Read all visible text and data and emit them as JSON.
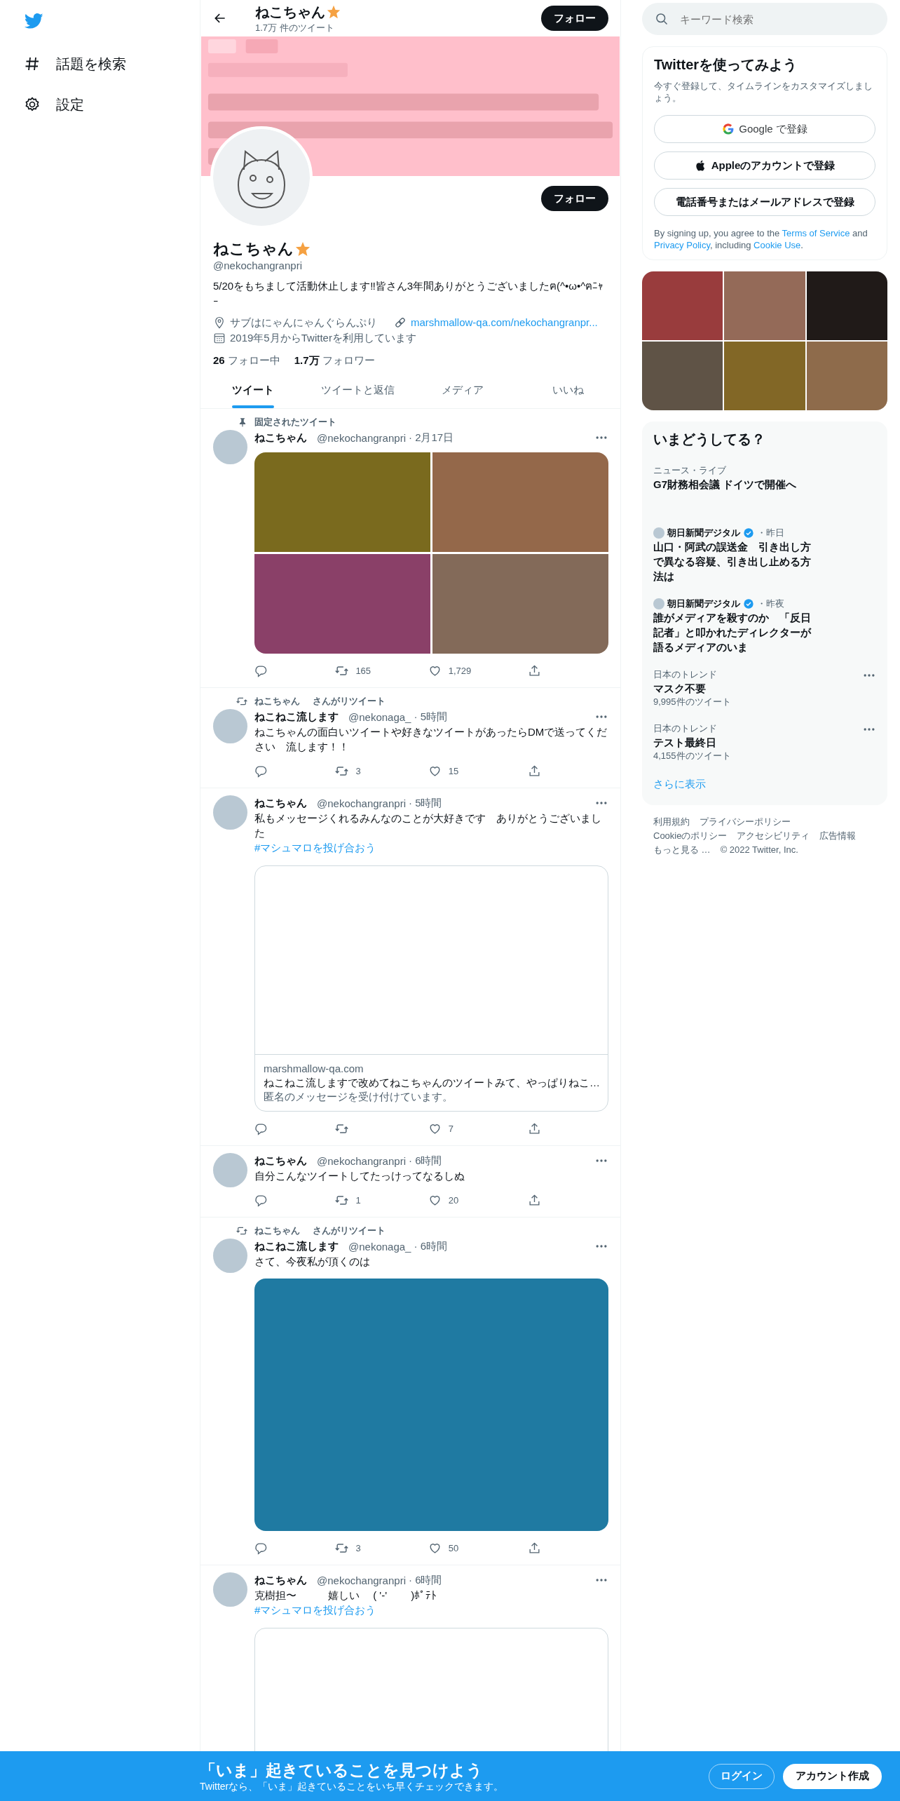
{
  "sidebar": {
    "items": [
      {
        "kind": "explore",
        "label": "話題を検索"
      },
      {
        "kind": "settings",
        "label": "設定"
      }
    ]
  },
  "header": {
    "name": "ねこちゃん",
    "tweet_count": "1.7万 件のツイート",
    "follow_button": "フォロー"
  },
  "profile": {
    "follow_button": "フォロー",
    "name": "ねこちゃん",
    "handle": "@nekochangranpri",
    "bio": "5/20をもちまして活動休止します‼皆さん3年間ありがとうございましたฅ(^•ω•^ฅﾆｬｰ",
    "location": "サブはにゃんにゃんぐらんぷり",
    "website": "marshmallow-qa.com/nekochangranpr...",
    "joined": "2019年5月からTwitterを利用しています",
    "following_count": "26",
    "following_label": "フォロー中",
    "followers_count": "1.7万",
    "followers_label": "フォロワー"
  },
  "tabs": [
    {
      "label": "ツイート",
      "selected": true
    },
    {
      "label": "ツイートと返信",
      "selected": false
    },
    {
      "label": "メディア",
      "selected": false
    },
    {
      "label": "いいね",
      "selected": false
    }
  ],
  "tweets": [
    {
      "context": {
        "kind": "pinned",
        "label": "固定されたツイート"
      },
      "name": "ねこちゃん",
      "handle": "@nekochangranpri",
      "time": "· 2月17日",
      "media": {
        "kind": "grid",
        "tiles": [
          {
            "color": "#7a6a1e"
          },
          {
            "color": "#94684a"
          },
          {
            "color": "#8a4068"
          },
          {
            "color": "#836a59"
          }
        ]
      },
      "retweets": "165",
      "likes": "1,729"
    },
    {
      "context": {
        "kind": "retweet",
        "user": "ねこちゃん",
        "label": "さんがリツイート"
      },
      "name": "ねこねこ流します",
      "handle": "@nekonaga_",
      "time": "· 5時間",
      "text": "ねこちゃんの面白いツイートや好きなツイートがあったらDMで送ってください　流します！！",
      "retweets": "3",
      "likes": "15"
    },
    {
      "name": "ねこちゃん",
      "handle": "@nekochangranpri",
      "time": "· 5時間",
      "text": "私もメッセージくれるみんなのことが大好きです　ありがとうございました",
      "hashtag": "#マシュマロを投げ合おう",
      "media": {
        "kind": "card",
        "domain": "marshmallow-qa.com",
        "title": "ねこねこ流しますで改めてねこちゃんのツイートみて、やっぱりねこ…",
        "description": "匿名のメッセージを受け付けています。"
      },
      "likes": "7"
    },
    {
      "name": "ねこちゃん",
      "handle": "@nekochangranpri",
      "time": "· 6時間",
      "text": "自分こんなツイートしてたっけってなるしぬ",
      "retweets": "1",
      "likes": "20"
    },
    {
      "context": {
        "kind": "retweet",
        "user": "ねこちゃん",
        "label": "さんがリツイート"
      },
      "name": "ねこねこ流します",
      "handle": "@nekonaga_",
      "time": "· 6時間",
      "text": "さて、今夜私が頂くのは",
      "retweets": "3",
      "likes": "50"
    },
    {
      "name": "ねこちゃん",
      "handle": "@nekochangranpri",
      "time": "· 6時間",
      "text": "克樹担〜　　　嬉しい　 ( '-'　　 )ﾎﾟﾃﾄ",
      "hashtag": "#マシュマロを投げ合おう",
      "media": {
        "kind": "card"
      }
    }
  ],
  "search": {
    "placeholder": "キーワード検索"
  },
  "signup": {
    "title": "Twitterを使ってみよう",
    "subtitle": "今すぐ登録して、タイムラインをカスタマイズしましょう。",
    "buttons": [
      {
        "kind": "google",
        "label": "Google で登録"
      },
      {
        "kind": "apple",
        "label": "Appleのアカウントで登録"
      },
      {
        "kind": "plain",
        "label": "電話番号またはメールアドレスで登録"
      }
    ],
    "legal": [
      {
        "text": "By signing up, you agree to the ",
        "link": false
      },
      {
        "text": "Terms of Service",
        "link": true
      },
      {
        "text": " and ",
        "link": false
      },
      {
        "text": "Privacy Policy",
        "link": true
      },
      {
        "text": ", including ",
        "link": false
      },
      {
        "text": "Cookie Use",
        "link": true
      },
      {
        "text": ".",
        "link": false
      }
    ]
  },
  "media_grid": [
    {
      "color": "#993c3d"
    },
    {
      "color": "#946a58"
    },
    {
      "color": "#201a18"
    },
    {
      "color": "#5f5346"
    },
    {
      "color": "#826726"
    },
    {
      "color": "#8e6b4b"
    }
  ],
  "trends": {
    "title": "いまどうしてる？",
    "items": [
      {
        "kind": "news",
        "category": "ニュース・ライブ",
        "title": "G7財務相会議 ドイツで開催へ"
      },
      {
        "kind": "article",
        "source": "朝日新聞デジタル",
        "verified": true,
        "time": "・昨日",
        "title": "山口・阿武の誤送金　引き出し方で異なる容疑、引き出し止める方法は"
      },
      {
        "kind": "article",
        "source": "朝日新聞デジタル",
        "verified": true,
        "time": "・昨夜",
        "title": "誰がメディアを殺すのか　「反日記者」と叩かれたディレクターが語るメディアのいま"
      },
      {
        "kind": "trend",
        "category": "日本のトレンド",
        "title": "マスク不要",
        "count": "9,995件のツイート"
      },
      {
        "kind": "trend",
        "category": "日本のトレンド",
        "title": "テスト最終日",
        "count": "4,155件のツイート"
      }
    ],
    "more": "さらに表示"
  },
  "footer": {
    "links": [
      "利用規約",
      "プライバシーポリシー",
      "Cookieのポリシー",
      "アクセシビリティ",
      "広告情報",
      "もっと見る …"
    ],
    "copyright": "© 2022 Twitter, Inc."
  },
  "bottom_bar": {
    "title": "「いま」起きていることを見つけよう",
    "subtitle": "Twitterなら、「いま」起きていることをいち早くチェックできます。",
    "login": "ログイン",
    "signup": "アカウント作成"
  }
}
